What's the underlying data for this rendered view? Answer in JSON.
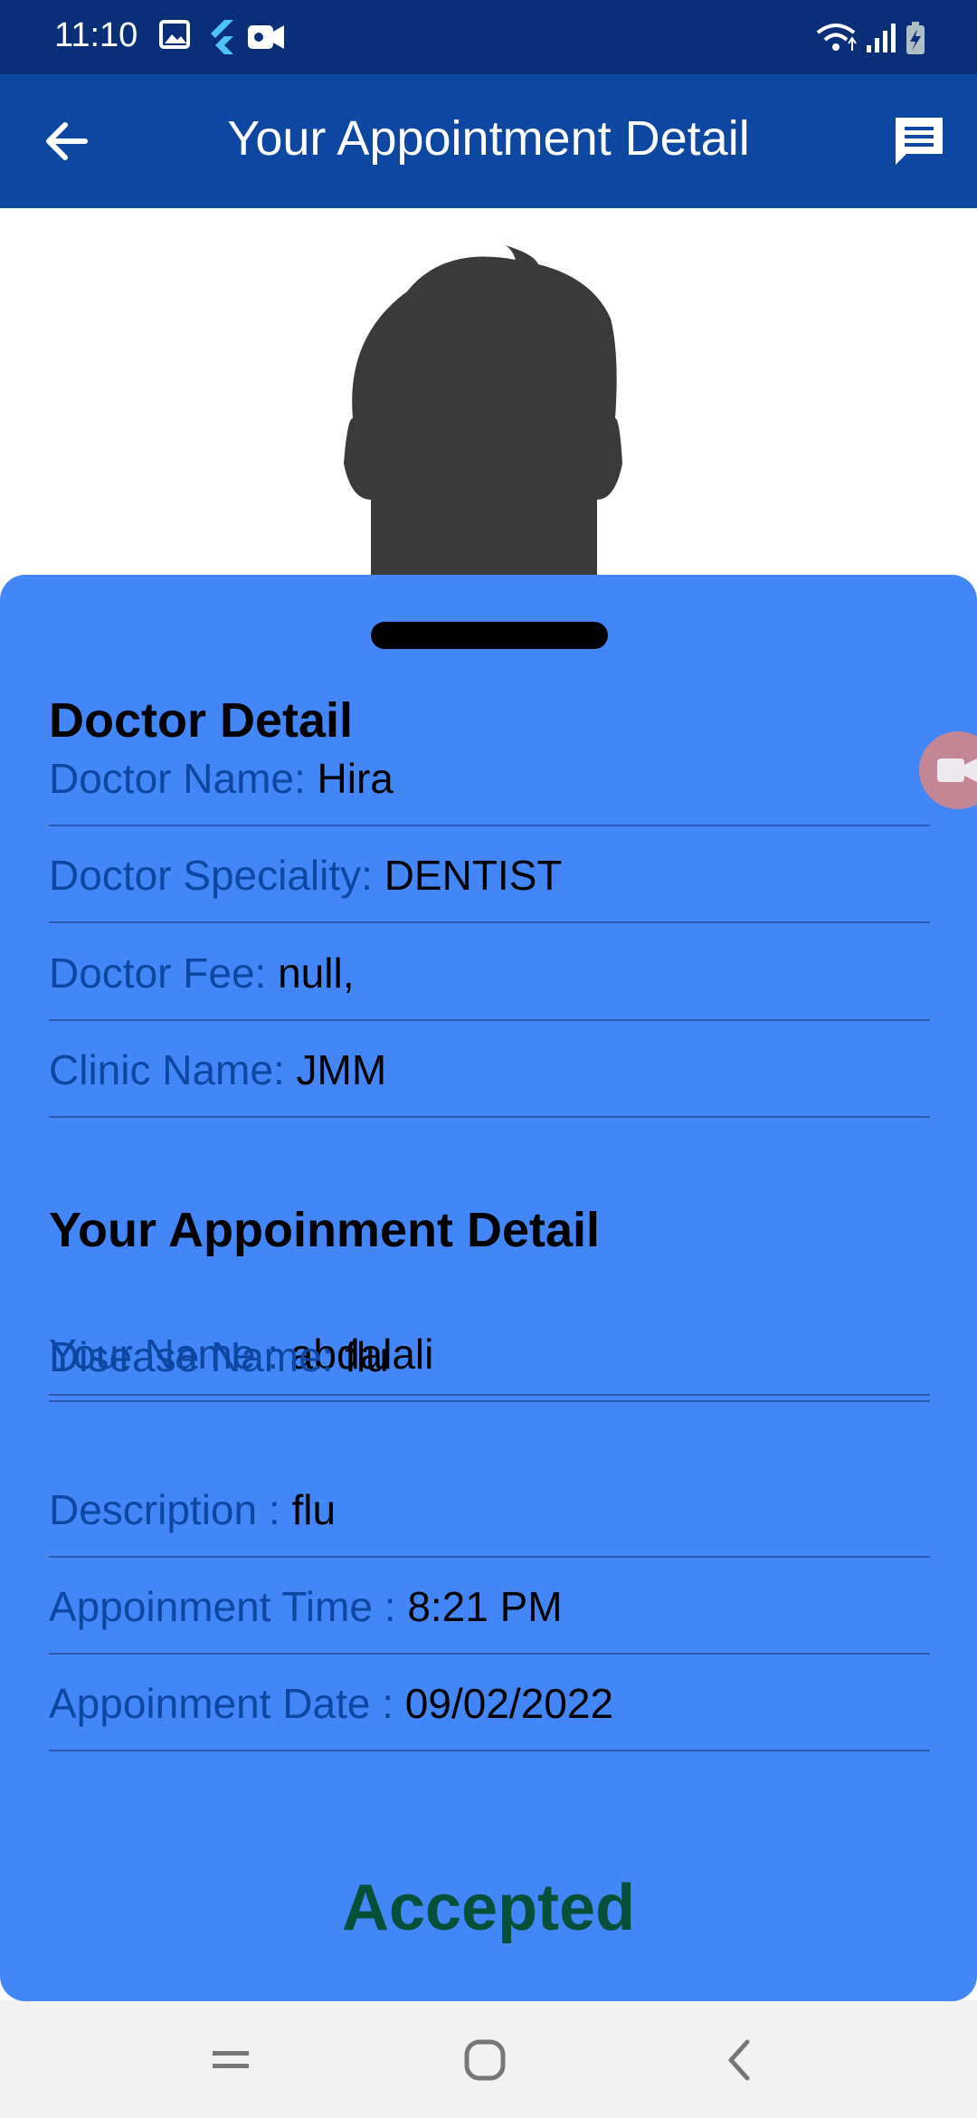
{
  "status_bar": {
    "time": "11:10",
    "left_icons": [
      "image-icon",
      "flutter-icon",
      "video-camera-icon"
    ],
    "right_icons": [
      "wifi-icon",
      "signal-icon",
      "battery-charging-icon"
    ]
  },
  "app_bar": {
    "title": "Your Appointment Detail",
    "back_icon": "arrow-left-icon",
    "chat_icon": "chat-message-icon",
    "color": "#0d47a1"
  },
  "avatar": {
    "icon": "person-silhouette-icon"
  },
  "doctor_section": {
    "title": "Doctor Detail",
    "rows": [
      {
        "label": "Doctor Name: ",
        "value": "Hira"
      },
      {
        "label": "Doctor Speciality: ",
        "value": "DENTIST"
      },
      {
        "label": "Doctor Fee: ",
        "value": "null,"
      },
      {
        "label": "Clinic Name: ",
        "value": "JMM"
      }
    ]
  },
  "appointment_section": {
    "title": "Your Appoinment Detail",
    "rows": [
      {
        "label": "Your Name : ",
        "value": "abdalali"
      },
      {
        "label": "Disease Name: ",
        "value": "flu"
      },
      {
        "label": "Description : ",
        "value": "flu"
      },
      {
        "label": "Appoinment Time : ",
        "value": "8:21 PM"
      },
      {
        "label": "Appoinment Date : ",
        "value": "09/02/2022"
      }
    ]
  },
  "status": {
    "text": "Accepted",
    "color": "#06503a"
  },
  "sheet_color": "#4286f8",
  "nav_bar": {
    "icons": [
      "recent-apps-icon",
      "home-icon",
      "back-icon"
    ]
  }
}
